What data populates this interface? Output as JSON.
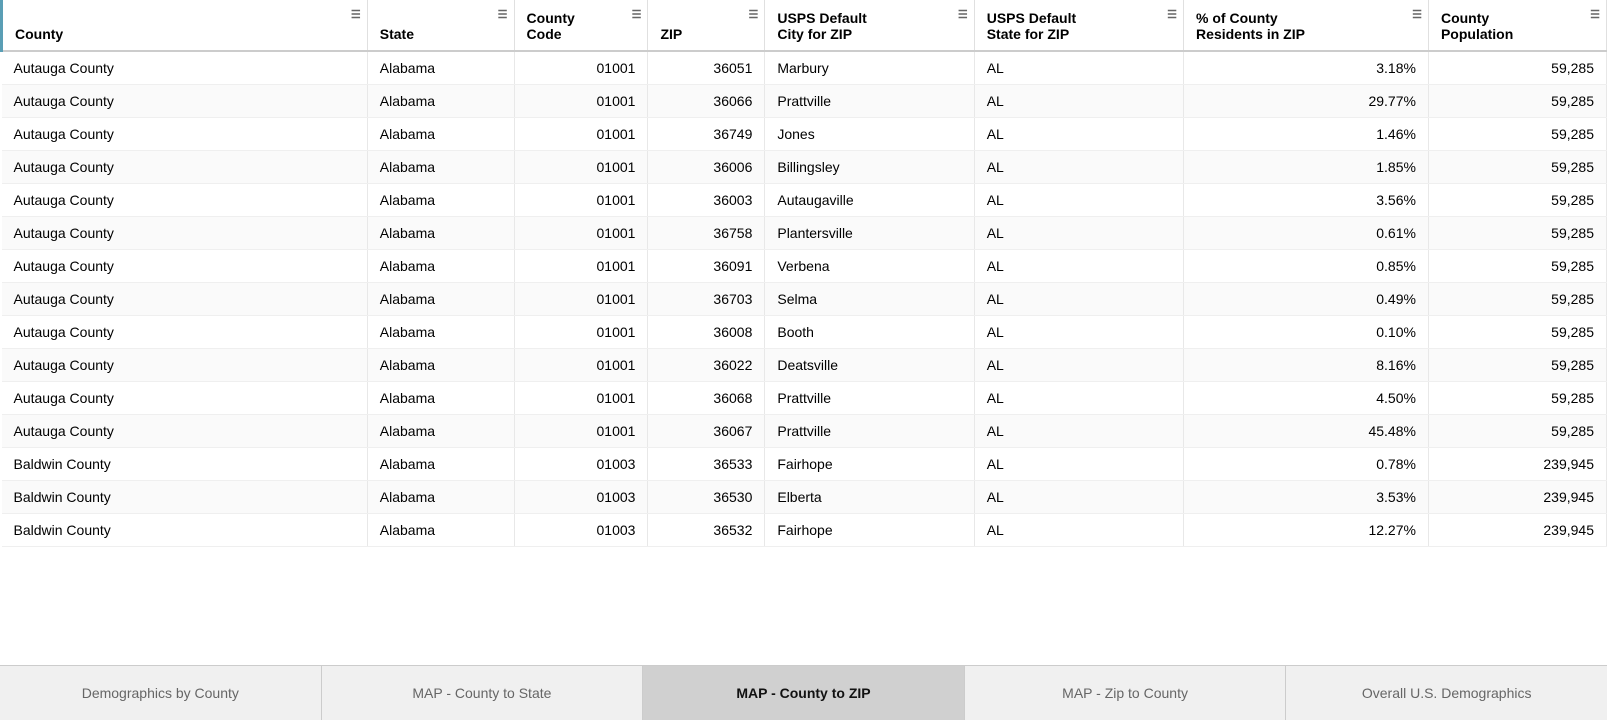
{
  "columns": [
    {
      "id": "county",
      "label": "County",
      "has_filter": true
    },
    {
      "id": "state",
      "label": "State",
      "has_filter": true
    },
    {
      "id": "county_code",
      "label": "County\nCode",
      "has_filter": true
    },
    {
      "id": "zip",
      "label": "ZIP",
      "has_filter": true
    },
    {
      "id": "usps_city",
      "label": "USPS Default\nCity for ZIP",
      "has_filter": true
    },
    {
      "id": "usps_state",
      "label": "USPS Default\nState for ZIP",
      "has_filter": true
    },
    {
      "id": "pct_residents",
      "label": "% of County\nResidents in ZIP",
      "has_filter": true
    },
    {
      "id": "county_pop",
      "label": "County\nPopulation",
      "has_filter": true
    }
  ],
  "rows": [
    {
      "county": "Autauga County",
      "state": "Alabama",
      "county_code": "01001",
      "zip": "36051",
      "usps_city": "Marbury",
      "usps_state": "AL",
      "pct_residents": "3.18%",
      "county_pop": "59,285"
    },
    {
      "county": "Autauga County",
      "state": "Alabama",
      "county_code": "01001",
      "zip": "36066",
      "usps_city": "Prattville",
      "usps_state": "AL",
      "pct_residents": "29.77%",
      "county_pop": "59,285"
    },
    {
      "county": "Autauga County",
      "state": "Alabama",
      "county_code": "01001",
      "zip": "36749",
      "usps_city": "Jones",
      "usps_state": "AL",
      "pct_residents": "1.46%",
      "county_pop": "59,285"
    },
    {
      "county": "Autauga County",
      "state": "Alabama",
      "county_code": "01001",
      "zip": "36006",
      "usps_city": "Billingsley",
      "usps_state": "AL",
      "pct_residents": "1.85%",
      "county_pop": "59,285"
    },
    {
      "county": "Autauga County",
      "state": "Alabama",
      "county_code": "01001",
      "zip": "36003",
      "usps_city": "Autaugaville",
      "usps_state": "AL",
      "pct_residents": "3.56%",
      "county_pop": "59,285"
    },
    {
      "county": "Autauga County",
      "state": "Alabama",
      "county_code": "01001",
      "zip": "36758",
      "usps_city": "Plantersville",
      "usps_state": "AL",
      "pct_residents": "0.61%",
      "county_pop": "59,285"
    },
    {
      "county": "Autauga County",
      "state": "Alabama",
      "county_code": "01001",
      "zip": "36091",
      "usps_city": "Verbena",
      "usps_state": "AL",
      "pct_residents": "0.85%",
      "county_pop": "59,285"
    },
    {
      "county": "Autauga County",
      "state": "Alabama",
      "county_code": "01001",
      "zip": "36703",
      "usps_city": "Selma",
      "usps_state": "AL",
      "pct_residents": "0.49%",
      "county_pop": "59,285"
    },
    {
      "county": "Autauga County",
      "state": "Alabama",
      "county_code": "01001",
      "zip": "36008",
      "usps_city": "Booth",
      "usps_state": "AL",
      "pct_residents": "0.10%",
      "county_pop": "59,285"
    },
    {
      "county": "Autauga County",
      "state": "Alabama",
      "county_code": "01001",
      "zip": "36022",
      "usps_city": "Deatsville",
      "usps_state": "AL",
      "pct_residents": "8.16%",
      "county_pop": "59,285"
    },
    {
      "county": "Autauga County",
      "state": "Alabama",
      "county_code": "01001",
      "zip": "36068",
      "usps_city": "Prattville",
      "usps_state": "AL",
      "pct_residents": "4.50%",
      "county_pop": "59,285"
    },
    {
      "county": "Autauga County",
      "state": "Alabama",
      "county_code": "01001",
      "zip": "36067",
      "usps_city": "Prattville",
      "usps_state": "AL",
      "pct_residents": "45.48%",
      "county_pop": "59,285"
    },
    {
      "county": "Baldwin County",
      "state": "Alabama",
      "county_code": "01003",
      "zip": "36533",
      "usps_city": "Fairhope",
      "usps_state": "AL",
      "pct_residents": "0.78%",
      "county_pop": "239,945"
    },
    {
      "county": "Baldwin County",
      "state": "Alabama",
      "county_code": "01003",
      "zip": "36530",
      "usps_city": "Elberta",
      "usps_state": "AL",
      "pct_residents": "3.53%",
      "county_pop": "239,945"
    },
    {
      "county": "Baldwin County",
      "state": "Alabama",
      "county_code": "01003",
      "zip": "36532",
      "usps_city": "Fairhope",
      "usps_state": "AL",
      "pct_residents": "12.27%",
      "county_pop": "239,945"
    }
  ],
  "tabs": [
    {
      "id": "demographics-by-county",
      "label": "Demographics by County",
      "active": false
    },
    {
      "id": "map-county-to-state",
      "label": "MAP - County to State",
      "active": false
    },
    {
      "id": "map-county-to-zip",
      "label": "MAP - County to ZIP",
      "active": true
    },
    {
      "id": "map-zip-to-county",
      "label": "MAP - Zip to County",
      "active": false
    },
    {
      "id": "overall-us-demographics",
      "label": "Overall U.S. Demographics",
      "active": false
    }
  ]
}
